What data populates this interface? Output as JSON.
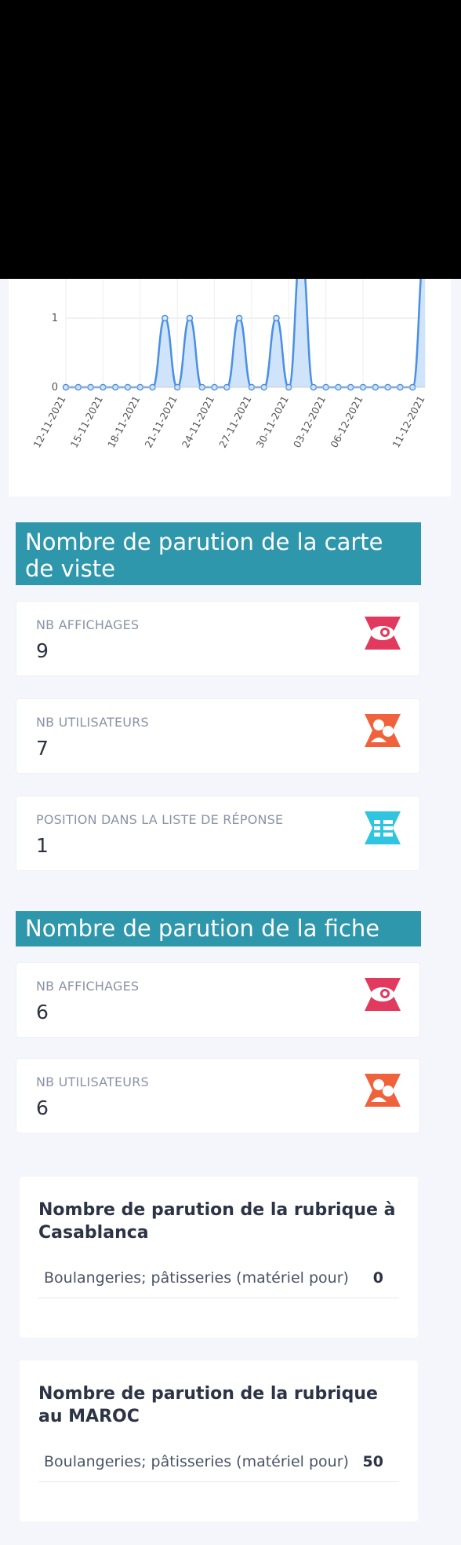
{
  "chart_data": {
    "type": "area",
    "x": [
      "12-11-2021",
      "13-11-2021",
      "14-11-2021",
      "15-11-2021",
      "16-11-2021",
      "17-11-2021",
      "18-11-2021",
      "19-11-2021",
      "20-11-2021",
      "21-11-2021",
      "22-11-2021",
      "23-11-2021",
      "24-11-2021",
      "25-11-2021",
      "26-11-2021",
      "27-11-2021",
      "28-11-2021",
      "29-11-2021",
      "30-11-2021",
      "01-12-2021",
      "02-12-2021",
      "03-12-2021",
      "04-12-2021",
      "05-12-2021",
      "06-12-2021",
      "07-12-2021",
      "08-12-2021",
      "09-12-2021",
      "10-12-2021",
      "11-12-2021"
    ],
    "x_ticks": [
      "12-11-2021",
      "15-11-2021",
      "18-11-2021",
      "21-11-2021",
      "24-11-2021",
      "27-11-2021",
      "30-11-2021",
      "03-12-2021",
      "06-12-2021",
      "11-12-2021"
    ],
    "values": [
      0,
      0,
      0,
      0,
      0,
      0,
      0,
      0,
      1,
      0,
      1,
      0,
      0,
      0,
      1,
      0,
      0,
      1,
      0,
      2,
      0,
      0,
      0,
      0,
      0,
      0,
      0,
      0,
      0,
      2
    ],
    "y_ticks": [
      "0",
      "1"
    ],
    "color": "#4a90e2",
    "grid": true
  },
  "sections": {
    "carte": {
      "title": "Nombre de parution de la carte de viste",
      "cards": [
        {
          "label": "NB AFFICHAGES",
          "value": "9",
          "icon": "eye-icon"
        },
        {
          "label": "NB UTILISATEURS",
          "value": "7",
          "icon": "users-icon"
        },
        {
          "label": "POSITION DANS LA LISTE DE RÉPONSE",
          "value": "1",
          "icon": "list-icon"
        }
      ]
    },
    "fiche": {
      "title": "Nombre de parution de la fiche",
      "cards": [
        {
          "label": "NB AFFICHAGES",
          "value": "6",
          "icon": "eye-icon"
        },
        {
          "label": "NB UTILISATEURS",
          "value": "6",
          "icon": "users-icon"
        }
      ]
    }
  },
  "rubriques": [
    {
      "title": "Nombre de parution de la rubrique à Casablanca",
      "row": {
        "name": "Boulangeries; pâtisseries (matériel pour)",
        "count": "0"
      }
    },
    {
      "title": "Nombre de parution de la rubrique au MAROC",
      "row": {
        "name": "Boulangeries; pâtisseries (matériel pour)",
        "count": "50"
      }
    }
  ],
  "colors": {
    "header": "#2f97ab",
    "eye": "#e23a5e",
    "users": "#f0623c",
    "list": "#2fc5e0",
    "line": "#4a90e2"
  }
}
